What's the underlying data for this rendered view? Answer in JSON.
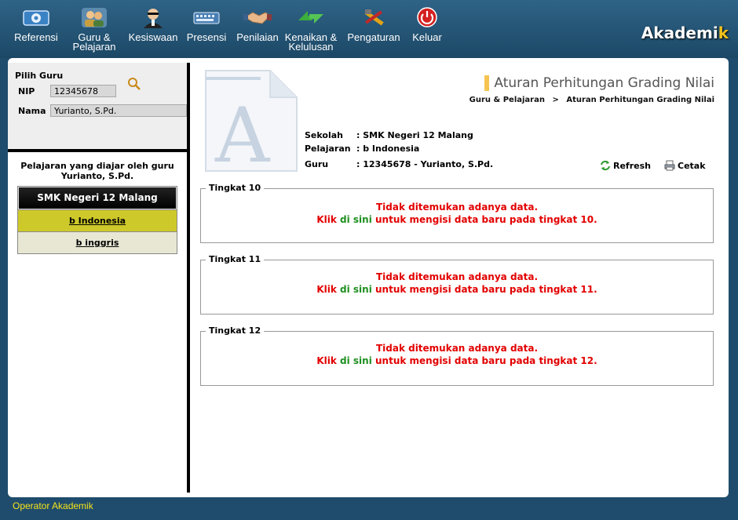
{
  "brand": {
    "main": "Akademi",
    "accent": "k"
  },
  "nav": [
    {
      "line1": "Referensi",
      "line2": ""
    },
    {
      "line1": "Guru &",
      "line2": "Pelajaran"
    },
    {
      "line1": "Kesiswaan",
      "line2": ""
    },
    {
      "line1": "Presensi",
      "line2": ""
    },
    {
      "line1": "Penilaian",
      "line2": ""
    },
    {
      "line1": "Kenaikan &",
      "line2": "Kelulusan"
    },
    {
      "line1": "Pengaturan",
      "line2": ""
    },
    {
      "line1": "Keluar",
      "line2": ""
    }
  ],
  "left": {
    "title": "Pilih Guru",
    "nip_label": "NIP",
    "nip_value": "12345678",
    "nama_label": "Nama",
    "nama_value": "Yurianto, S.Pd.",
    "subjects_title_1": "Pelajaran yang diajar oleh guru",
    "subjects_title_2": "Yurianto, S.Pd.",
    "school": "SMK Negeri 12 Malang",
    "subjects": [
      "b Indonesia",
      "b inggris"
    ]
  },
  "header": {
    "title": "Aturan Perhitungan Grading Nilai",
    "breadcrumb_parent": "Guru & Pelajaran",
    "breadcrumb_sep": ">",
    "breadcrumb_current": "Aturan Perhitungan Grading Nilai"
  },
  "info": {
    "sekolah_label": "Sekolah",
    "sekolah_value": ": SMK Negeri 12 Malang",
    "pelajaran_label": "Pelajaran",
    "pelajaran_value": ": b Indonesia",
    "guru_label": "Guru",
    "guru_value": ": 12345678 - Yurianto, S.Pd."
  },
  "actions": {
    "refresh": "Refresh",
    "cetak": "Cetak"
  },
  "levels": [
    {
      "legend": "Tingkat 10",
      "empty": "Tidak ditemukan adanya data.",
      "klik": "Klik",
      "link": "di sini",
      "rest": "untuk mengisi data baru pada tingkat 10."
    },
    {
      "legend": "Tingkat 11",
      "empty": "Tidak ditemukan adanya data.",
      "klik": "Klik",
      "link": "di sini",
      "rest": "untuk mengisi data baru pada tingkat 11."
    },
    {
      "legend": "Tingkat 12",
      "empty": "Tidak ditemukan adanya data.",
      "klik": "Klik",
      "link": "di sini",
      "rest": "untuk mengisi data baru pada tingkat 12."
    }
  ],
  "footer": "Operator Akademik",
  "colors": {
    "topbar": "#2a5b7e",
    "selected_subject": "#cec92a",
    "error_text": "#e30000",
    "link_text": "#1f8f1f",
    "footer_text": "#f5e31b"
  }
}
